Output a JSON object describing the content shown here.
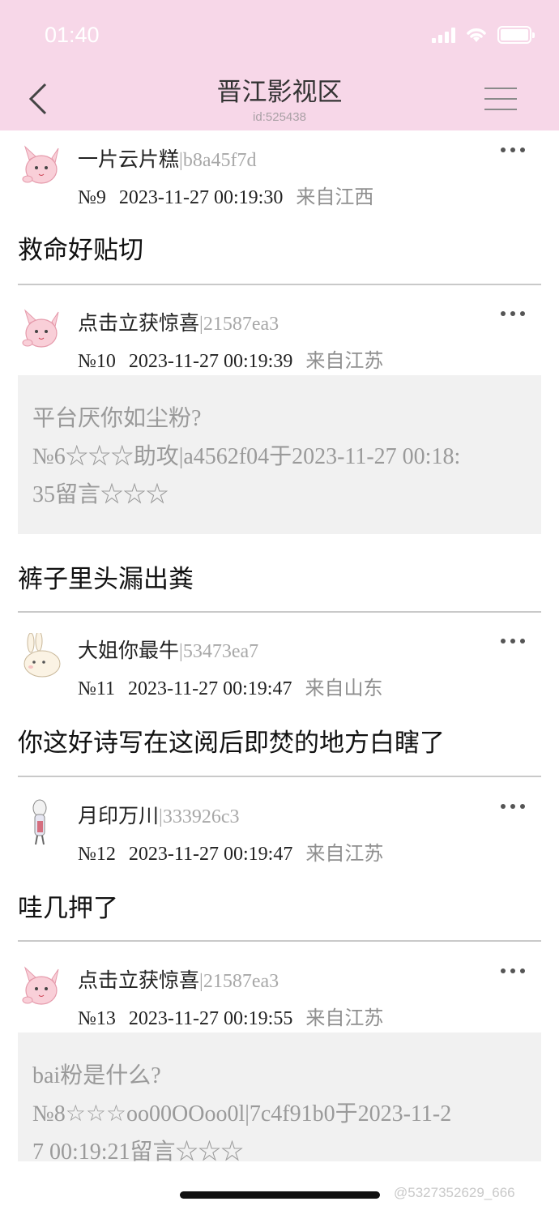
{
  "status": {
    "time": "01:40"
  },
  "nav": {
    "title": "晋江影视区",
    "subtitle": "id:525438"
  },
  "posts": [
    {
      "author": "一片云片糕",
      "uid": "|b8a45f7d",
      "floor": "№9",
      "datetime": "2023-11-27 00:19:30",
      "location": "来自江西",
      "body": "救命好贴切"
    },
    {
      "author": "点击立获惊喜",
      "uid": "|21587ea3",
      "floor": "№10",
      "datetime": "2023-11-27 00:19:39",
      "location": "来自江苏",
      "quote": {
        "line1": "平台厌你如尘粉?",
        "line2": "№6☆☆☆助攻|a4562f04于2023-11-27 00:18:",
        "line3": "35留言☆☆☆"
      },
      "body": "裤子里头漏出粪"
    },
    {
      "author": "大姐你最牛",
      "uid": "|53473ea7",
      "floor": "№11",
      "datetime": "2023-11-27 00:19:47",
      "location": "来自山东",
      "body": "你这好诗写在这阅后即焚的地方白瞎了"
    },
    {
      "author": "月印万川",
      "uid": "|333926c3",
      "floor": "№12",
      "datetime": "2023-11-27 00:19:47",
      "location": "来自江苏",
      "body": "哇几押了"
    },
    {
      "author": "点击立获惊喜",
      "uid": "|21587ea3",
      "floor": "№13",
      "datetime": "2023-11-27 00:19:55",
      "location": "来自江苏",
      "quote": {
        "line1": "bai粉是什么?",
        "line2": "№8☆☆☆oo00OOoo0l|7c4f91b0于2023-11-2",
        "line3": "7 00:19:21留言☆☆☆"
      }
    }
  ],
  "watermark": "@5327352629_666",
  "colors": {
    "header_bg": "#f7d7e8",
    "quote_bg": "#f1f1f1",
    "muted": "#a8a8a8"
  }
}
